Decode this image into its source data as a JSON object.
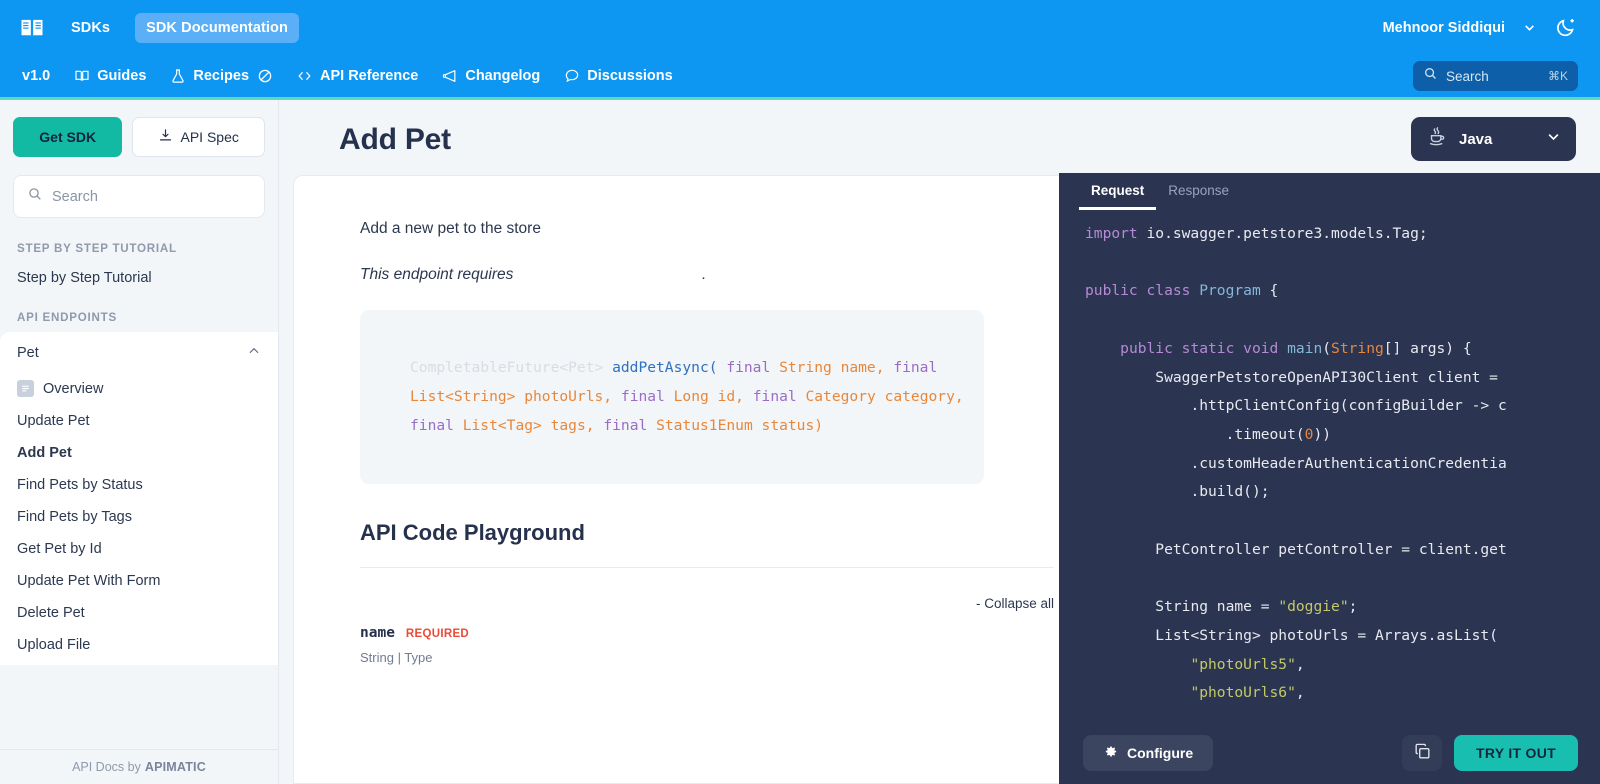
{
  "topbar": {
    "logo_icon": "open-book-icon",
    "links": [
      {
        "label": "SDKs",
        "active": false
      },
      {
        "label": "SDK Documentation",
        "active": true
      }
    ],
    "user": "Mehnoor Siddiqui",
    "user_chevron": "chevron-down-icon",
    "theme_icon": "moon-icon"
  },
  "nav": {
    "version": "v1.0",
    "items": [
      {
        "label": "Guides",
        "icon": "book-icon"
      },
      {
        "label": "Recipes",
        "icon": "flask-icon",
        "suffix_icon": "no-entry-icon"
      },
      {
        "label": "API Reference",
        "icon": "code-brackets-icon"
      },
      {
        "label": "Changelog",
        "icon": "megaphone-icon"
      },
      {
        "label": "Discussions",
        "icon": "chat-bubble-icon"
      }
    ],
    "search": {
      "placeholder": "Search",
      "shortcut": "⌘K",
      "icon": "search-icon"
    },
    "accent_color": "#5fd9bd",
    "bar_color": "#0d96f2"
  },
  "sidebar": {
    "get_sdk_label": "Get SDK",
    "api_spec_label": "API Spec",
    "api_spec_icon": "download-icon",
    "search": {
      "placeholder": "Search",
      "icon": "search-icon"
    },
    "sections": [
      {
        "heading": "STEP BY STEP TUTORIAL",
        "items": [
          {
            "label": "Step by Step Tutorial",
            "selected": false
          }
        ]
      },
      {
        "heading": "API ENDPOINTS",
        "group": {
          "label": "Pet",
          "expanded": true,
          "chevron": "chevron-up-icon",
          "items": [
            {
              "label": "Overview",
              "icon": "document-icon",
              "selected": false
            },
            {
              "label": "Update Pet",
              "selected": false
            },
            {
              "label": "Add Pet",
              "selected": true
            },
            {
              "label": "Find Pets by Status",
              "selected": false
            },
            {
              "label": "Find Pets by Tags",
              "selected": false
            },
            {
              "label": "Get Pet by Id",
              "selected": false
            },
            {
              "label": "Update Pet With Form",
              "selected": false
            },
            {
              "label": "Delete Pet",
              "selected": false
            },
            {
              "label": "Upload File",
              "selected": false
            }
          ]
        }
      }
    ],
    "footer_prefix": "API Docs by",
    "footer_brand": "APIMATIC"
  },
  "main": {
    "title": "Add Pet",
    "description": "Add a new pet to the store",
    "requires_prefix": "This endpoint requires",
    "requires_suffix": ".",
    "signature": {
      "return_type": "CompletableFuture<Pet>",
      "method": "addPetAsync(",
      "params": [
        {
          "mod": "final",
          "type": "String",
          "name": "name,"
        },
        {
          "mod": "final",
          "type": "List<String>",
          "name": "photoUrls,"
        },
        {
          "mod": "final",
          "type": "Long",
          "name": "id,"
        },
        {
          "mod": "final",
          "type": "Category",
          "name": "category,"
        },
        {
          "mod": "final",
          "type": "List<Tag>",
          "name": "tags,"
        },
        {
          "mod": "final",
          "type": "Status1Enum",
          "name": "status)"
        }
      ]
    },
    "playground_title": "API Code Playground",
    "collapse_all": "- Collapse all",
    "params": [
      {
        "name": "name",
        "badge": "REQUIRED",
        "type": "String | Type"
      }
    ]
  },
  "lang_select": {
    "label": "Java",
    "icon": "java-coffee-icon",
    "chevron": "chevron-down-icon"
  },
  "code_panel": {
    "tabs": [
      {
        "label": "Request",
        "active": true
      },
      {
        "label": "Response",
        "active": false
      }
    ],
    "collapse_handle_icon": "chevron-left-icon",
    "language": "Java",
    "code_lines": [
      {
        "indent": 0,
        "tokens": [
          {
            "t": "import",
            "c": "kw"
          },
          {
            "t": " io.swagger.petstore3.models.Tag;",
            "c": "pl"
          }
        ]
      },
      {
        "indent": 0,
        "tokens": []
      },
      {
        "indent": 0,
        "tokens": [
          {
            "t": "public class ",
            "c": "kw"
          },
          {
            "t": "Program",
            "c": "cls"
          },
          {
            "t": " {",
            "c": "pl"
          }
        ]
      },
      {
        "indent": 0,
        "tokens": []
      },
      {
        "indent": 1,
        "tokens": [
          {
            "t": "public static void ",
            "c": "kw"
          },
          {
            "t": "main",
            "c": "cls"
          },
          {
            "t": "(",
            "c": "pl"
          },
          {
            "t": "String",
            "c": "ty"
          },
          {
            "t": "[] args) {",
            "c": "pl"
          }
        ]
      },
      {
        "indent": 2,
        "tokens": [
          {
            "t": "SwaggerPetstoreOpenAPI30Client client =",
            "c": "pl"
          }
        ]
      },
      {
        "indent": 3,
        "tokens": [
          {
            "t": ".httpClientConfig(configBuilder -> c",
            "c": "pl"
          }
        ]
      },
      {
        "indent": 4,
        "tokens": [
          {
            "t": ".timeout(",
            "c": "pl"
          },
          {
            "t": "0",
            "c": "num"
          },
          {
            "t": "))",
            "c": "pl"
          }
        ]
      },
      {
        "indent": 3,
        "tokens": [
          {
            "t": ".customHeaderAuthenticationCredentia",
            "c": "pl"
          }
        ]
      },
      {
        "indent": 3,
        "tokens": [
          {
            "t": ".build();",
            "c": "pl"
          }
        ]
      },
      {
        "indent": 0,
        "tokens": []
      },
      {
        "indent": 2,
        "tokens": [
          {
            "t": "PetController petController = client.get",
            "c": "pl"
          }
        ]
      },
      {
        "indent": 0,
        "tokens": []
      },
      {
        "indent": 2,
        "tokens": [
          {
            "t": "String name = ",
            "c": "pl"
          },
          {
            "t": "\"doggie\"",
            "c": "str"
          },
          {
            "t": ";",
            "c": "pl"
          }
        ]
      },
      {
        "indent": 2,
        "tokens": [
          {
            "t": "List<String> photoUrls = Arrays.asList(",
            "c": "pl"
          }
        ]
      },
      {
        "indent": 3,
        "tokens": [
          {
            "t": "\"photoUrls5\"",
            "c": "str"
          },
          {
            "t": ",",
            "c": "pl"
          }
        ]
      },
      {
        "indent": 3,
        "tokens": [
          {
            "t": "\"photoUrls6\"",
            "c": "str"
          },
          {
            "t": ",",
            "c": "pl"
          }
        ]
      }
    ],
    "configure_label": "Configure",
    "configure_icon": "gear-icon",
    "copy_icon": "copy-icon",
    "try_it_out_label": "TRY IT OUT",
    "accent_color": "#18bfb0"
  }
}
